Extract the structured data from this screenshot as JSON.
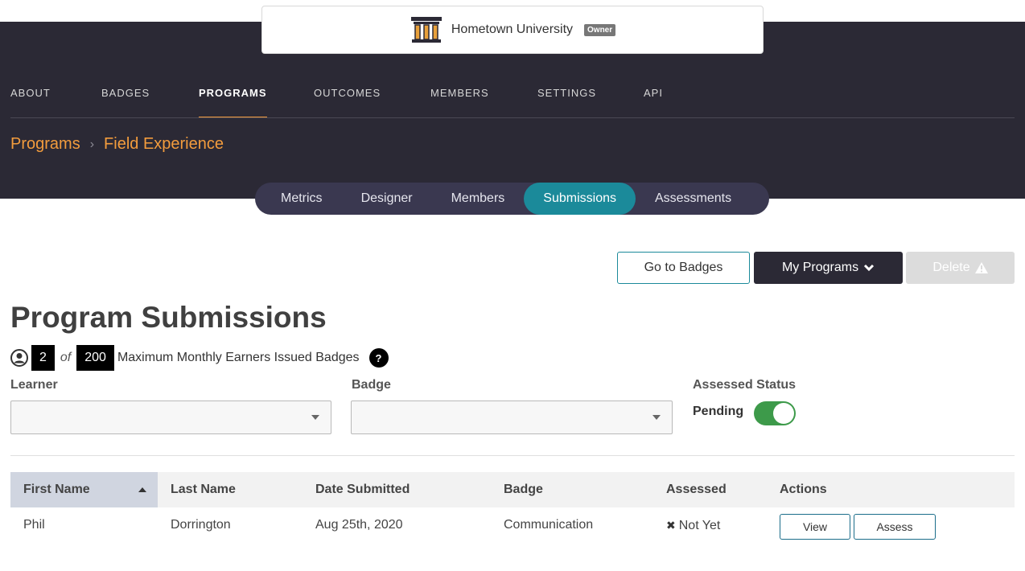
{
  "org": {
    "name": "Hometown University",
    "role_badge": "Owner",
    "logo": "pillars-logo"
  },
  "nav": {
    "items": [
      {
        "label": "ABOUT"
      },
      {
        "label": "BADGES"
      },
      {
        "label": "PROGRAMS"
      },
      {
        "label": "OUTCOMES"
      },
      {
        "label": "MEMBERS"
      },
      {
        "label": "SETTINGS"
      },
      {
        "label": "API"
      }
    ],
    "active": "PROGRAMS",
    "accent_color": "#f39c3d"
  },
  "breadcrumb": {
    "root": "Programs",
    "current": "Field Experience"
  },
  "tabs": {
    "items": [
      {
        "label": "Metrics"
      },
      {
        "label": "Designer"
      },
      {
        "label": "Members"
      },
      {
        "label": "Submissions"
      },
      {
        "label": "Assessments"
      }
    ],
    "active": "Submissions",
    "active_color": "#1b8a9a"
  },
  "actions": {
    "go_to_badges": "Go to Badges",
    "my_programs": "My Programs",
    "delete": "Delete"
  },
  "page": {
    "title": "Program Submissions"
  },
  "quota": {
    "used": "2",
    "of_label": "of",
    "limit": "200",
    "description": "Maximum Monthly Earners Issued Badges",
    "help": "?"
  },
  "filters": {
    "learner_label": "Learner",
    "learner_value": "",
    "badge_label": "Badge",
    "badge_value": "",
    "assessed_status_label": "Assessed Status",
    "pending_label": "Pending",
    "pending_on": true
  },
  "table": {
    "columns": [
      "First Name",
      "Last Name",
      "Date Submitted",
      "Badge",
      "Assessed",
      "Actions"
    ],
    "sorted_column": "First Name",
    "rows": [
      {
        "first_name": "Phil",
        "last_name": "Dorrington",
        "date_submitted": "Aug 25th, 2020",
        "badge": "Communication",
        "assessed": "Not Yet",
        "view": "View",
        "assess": "Assess"
      }
    ]
  }
}
